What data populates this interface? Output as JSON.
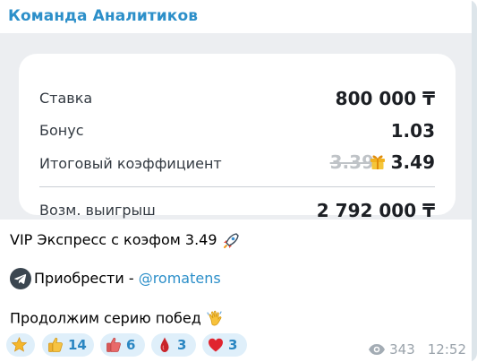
{
  "channel": {
    "sender_name": "Команда Аналитиков"
  },
  "bet_card": {
    "rows": [
      {
        "label": "Ставка",
        "value": "800 000 ₸"
      },
      {
        "label": "Бонус",
        "value": "1.03"
      },
      {
        "label": "Итоговый коэффициент",
        "old_value": "3.39",
        "value": "3.49"
      },
      {
        "label": "Возм. выигрыш",
        "value": "2 792 000 ₸"
      }
    ],
    "icons": {
      "bonus": "gift-icon"
    }
  },
  "text": {
    "line1": "VIP Экспресс с коэфом 3.49",
    "line1_icon": "rocket-icon",
    "line2_prefix": "Приобрести - ",
    "line2_mention": "@romatens",
    "line2_icon": "telegram-icon",
    "line3": "Продолжим серию побед",
    "line3_icon": "waving-hand-icon"
  },
  "reactions": [
    {
      "icon": "star-icon",
      "count": ""
    },
    {
      "icon": "thumbs-up-icon",
      "count": "14"
    },
    {
      "icon": "thumbs-down-icon",
      "count": "6"
    },
    {
      "icon": "blood-drop-icon",
      "count": "3"
    },
    {
      "icon": "heart-icon",
      "count": "3"
    }
  ],
  "meta": {
    "views": "343",
    "time": "12:52"
  },
  "colors": {
    "accent": "#2c8fc9",
    "reaction_bg": "#dfeffa",
    "media_bg": "#eceef1"
  }
}
